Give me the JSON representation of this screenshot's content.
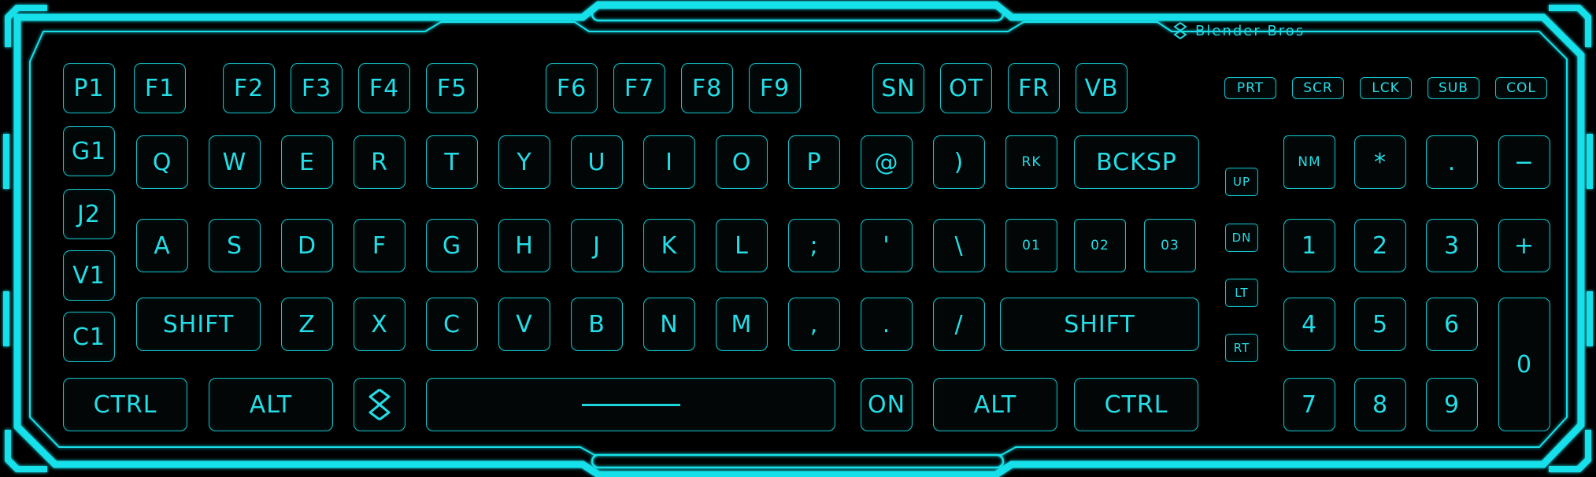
{
  "brand": {
    "name": "Blender Bros",
    "icon": "blender-bros-logo-icon"
  },
  "colors": {
    "accent": "#22d6e0",
    "frame": "#19e0ea",
    "background": "#000000",
    "key_face": "#020606"
  },
  "macro_keys": [
    "P1",
    "G1",
    "J2",
    "V1",
    "C1"
  ],
  "function_keys": [
    "F1",
    "F2",
    "F3",
    "F4",
    "F5",
    "F6",
    "F7",
    "F8",
    "F9"
  ],
  "mode_keys": [
    "SN",
    "OT",
    "FR",
    "VB"
  ],
  "status_keys": [
    "PRT",
    "SCR",
    "LCK",
    "SUB",
    "COL"
  ],
  "row_q": [
    "Q",
    "W",
    "E",
    "R",
    "T",
    "Y",
    "U",
    "I",
    "O",
    "P",
    "@",
    ")",
    "RK",
    "BCKSP"
  ],
  "row_a": [
    "A",
    "S",
    "D",
    "F",
    "G",
    "H",
    "J",
    "K",
    "L",
    ";",
    "'",
    "\\",
    "01",
    "02",
    "03"
  ],
  "row_z": [
    "SHIFT",
    "Z",
    "X",
    "C",
    "V",
    "B",
    "N",
    "M",
    ",",
    ".",
    "/",
    "SHIFT"
  ],
  "row_bottom": {
    "ctrl_left": "CTRL",
    "alt_left": "ALT",
    "logo": "blender-bros-logo-icon",
    "space": "spacebar",
    "on": "ON",
    "alt_right": "ALT",
    "ctrl_right": "CTRL"
  },
  "nav_keys": [
    "UP",
    "DN",
    "LT",
    "RT"
  ],
  "numpad": {
    "row1": [
      "NM",
      "*",
      ".",
      "−"
    ],
    "row2": [
      "1",
      "2",
      "3",
      "+"
    ],
    "row3": [
      "4",
      "5",
      "6"
    ],
    "row4": [
      "7",
      "8",
      "9"
    ],
    "zero": "0"
  }
}
